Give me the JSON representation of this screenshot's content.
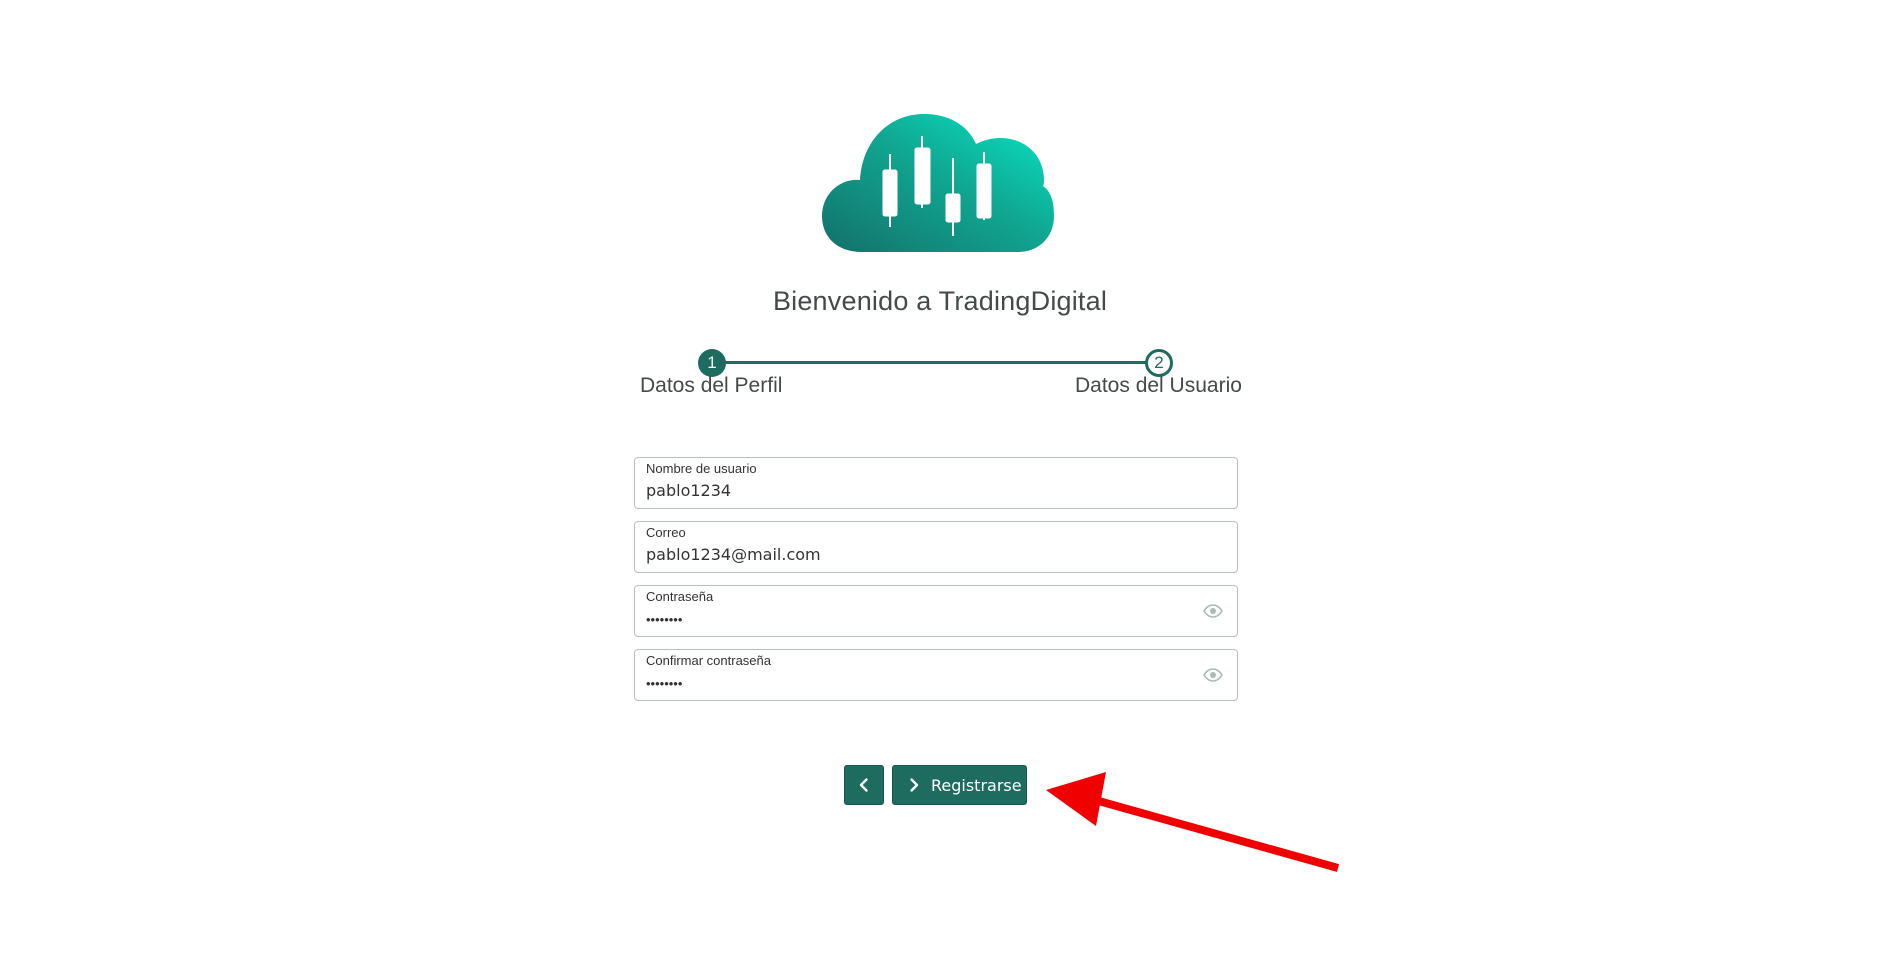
{
  "app": {
    "welcome_title": "Bienvenido a TradingDigital",
    "brand_colors": {
      "primary": "#1e6b5f",
      "logo_gradient_start": "#16756a",
      "logo_gradient_end": "#0ce3c4",
      "annotation_arrow": "#f00000"
    }
  },
  "stepper": {
    "steps": [
      {
        "number": "1",
        "label": "Datos del Perfil",
        "state": "completed"
      },
      {
        "number": "2",
        "label": "Datos del Usuario",
        "state": "active"
      }
    ]
  },
  "form": {
    "fields": [
      {
        "label": "Nombre de usuario",
        "value": "pablo1234",
        "type": "text"
      },
      {
        "label": "Correo",
        "value": "pablo1234@mail.com",
        "type": "email"
      },
      {
        "label": "Contraseña",
        "value": "••••••••",
        "type": "password",
        "icon": "eye-icon"
      },
      {
        "label": "Confirmar contraseña",
        "value": "••••••••",
        "type": "password",
        "icon": "eye-icon"
      }
    ]
  },
  "actions": {
    "back_icon": "chevron-left-icon",
    "register_icon": "chevron-right-icon",
    "register_label": "Registrarse"
  }
}
